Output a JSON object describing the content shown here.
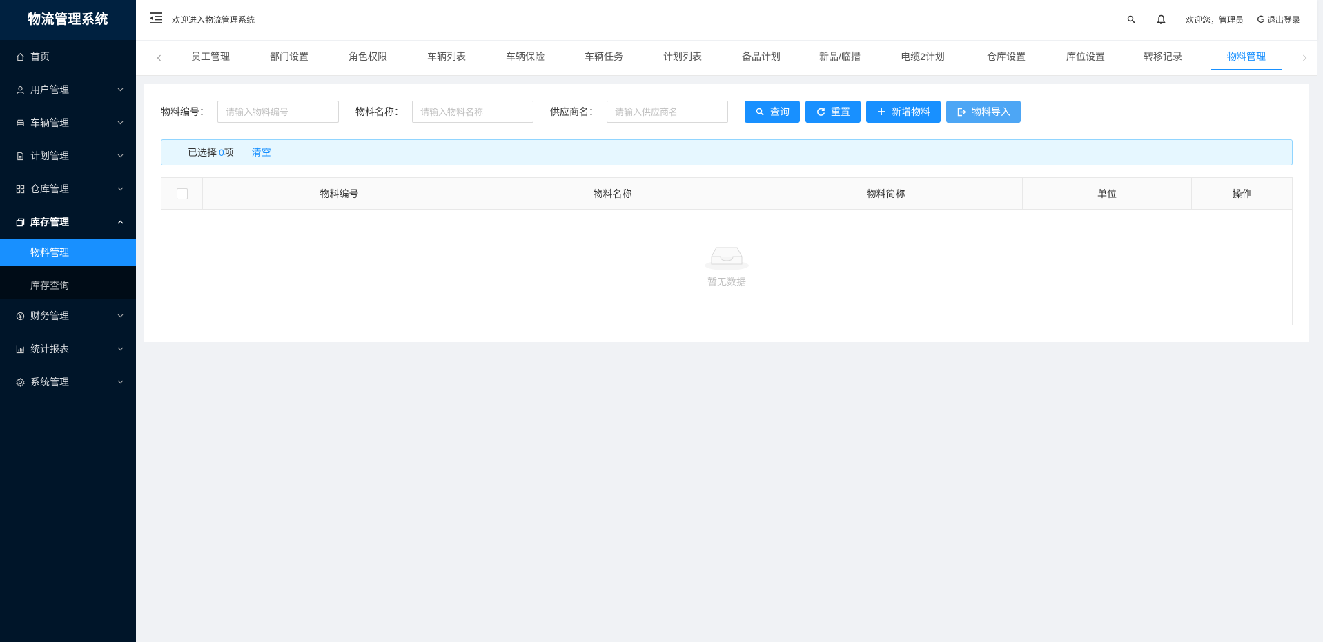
{
  "sidebar": {
    "logo": "物流管理系统",
    "items": [
      {
        "label": "首页",
        "icon": "home-icon",
        "has_arrow": false
      },
      {
        "label": "用户管理",
        "icon": "user-icon",
        "has_arrow": true
      },
      {
        "label": "车辆管理",
        "icon": "car-icon",
        "has_arrow": true
      },
      {
        "label": "计划管理",
        "icon": "file-icon",
        "has_arrow": true
      },
      {
        "label": "仓库管理",
        "icon": "grid-icon",
        "has_arrow": true
      },
      {
        "label": "库存管理",
        "icon": "copy-icon",
        "has_arrow": true,
        "expanded": true
      },
      {
        "label": "财务管理",
        "icon": "yen-icon",
        "has_arrow": true
      },
      {
        "label": "统计报表",
        "icon": "bar-chart-icon",
        "has_arrow": true
      },
      {
        "label": "系统管理",
        "icon": "gear-icon",
        "has_arrow": true
      }
    ],
    "submenu": [
      {
        "label": "物料管理",
        "active": true
      },
      {
        "label": "库存查询",
        "active": false
      }
    ]
  },
  "header": {
    "welcome": "欢迎进入物流管理系统",
    "greeting": "欢迎您，管理员",
    "logout": "退出登录"
  },
  "tabs": [
    "员工管理",
    "部门设置",
    "角色权限",
    "车辆列表",
    "车辆保险",
    "车辆任务",
    "计划列表",
    "备品计划",
    "新品/临措",
    "电缆2计划",
    "仓库设置",
    "库位设置",
    "转移记录",
    "物料管理"
  ],
  "active_tab": "物料管理",
  "search": {
    "code_label": "物料编号：",
    "code_placeholder": "请输入物料编号",
    "name_label": "物料名称：",
    "name_placeholder": "请输入物料名称",
    "supplier_label": "供应商名：",
    "supplier_placeholder": "请输入供应商名",
    "query_button": "查询",
    "reset_button": "重置",
    "add_button": "新增物料",
    "import_button": "物料导入"
  },
  "alert": {
    "prefix": "已选择",
    "count": "0",
    "suffix": "项",
    "clear": "清空"
  },
  "table": {
    "columns": [
      "物料编号",
      "物料名称",
      "物料简称",
      "单位",
      "操作"
    ],
    "empty_text": "暂无数据"
  },
  "colors": {
    "primary": "#1890ff",
    "sidebar_bg": "#001529"
  }
}
